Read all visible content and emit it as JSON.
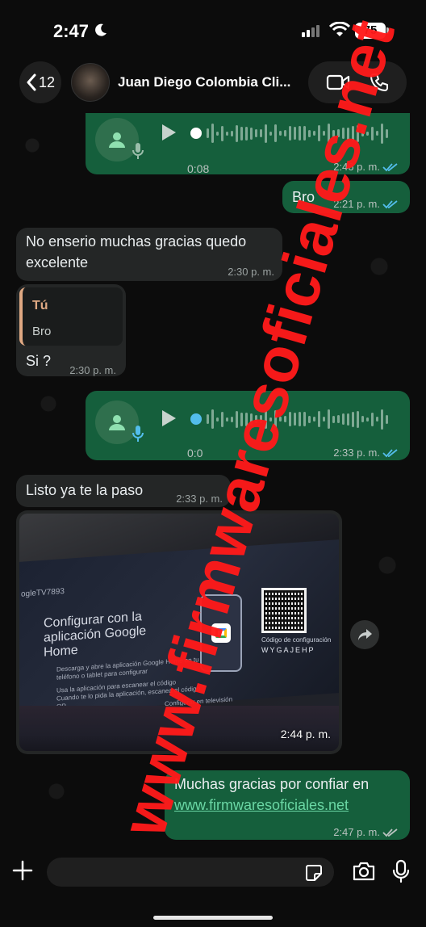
{
  "status_bar": {
    "time": "2:47",
    "battery": "75"
  },
  "header": {
    "back_count": "12",
    "contact_name": "Juan Diego Colombia Cli..."
  },
  "messages": [
    {
      "id": "m1",
      "type": "voice",
      "direction": "out",
      "duration": "0:08",
      "time": "2:46 p. m."
    },
    {
      "id": "m2",
      "type": "text",
      "direction": "out",
      "text": "Bro",
      "time": "2:21 p. m."
    },
    {
      "id": "m3",
      "type": "text",
      "direction": "in",
      "text": "No enserio muchas gracias quedo excelente",
      "time": "2:30 p. m."
    },
    {
      "id": "m4",
      "type": "reply",
      "direction": "in",
      "quote_author": "Tú",
      "quote_text": "Bro",
      "text": "Si ?",
      "time": "2:30 p. m."
    },
    {
      "id": "m5",
      "type": "voice",
      "direction": "out",
      "duration": "0:0",
      "time": "2:33 p. m."
    },
    {
      "id": "m6",
      "type": "text",
      "direction": "in",
      "text": "Listo ya te la paso",
      "time": "2:33 p. m."
    },
    {
      "id": "m7",
      "type": "image",
      "direction": "in",
      "time": "2:44 p. m.",
      "photo_text": {
        "device_id": "ogleTV7893",
        "title": "Configurar con la aplicación Google Home",
        "line1": "Descarga y abre la aplicación Google Home en tu",
        "line2": "teléfono o tablet para configurar",
        "line3": "Usa la aplicación para escanear el código",
        "line4": "Cuando te lo pida la aplicación, escanea el código",
        "line5": "QR.",
        "bottom": "Configurar en televisión",
        "qr_caption": "Código de configuración",
        "qr_code": "WYGAJEHP"
      }
    },
    {
      "id": "m8",
      "type": "text",
      "direction": "out",
      "text": "Muchas gracias por confiar en",
      "link": "www.firmwaresoficiales.net",
      "time": "2:47 p. m."
    }
  ],
  "input": {
    "placeholder": ""
  },
  "watermark": "www.firmwaresoficiales.net",
  "colors": {
    "outgoing": "#155f3c",
    "incoming": "#242626",
    "read_ticks": "#53bdeb",
    "watermark": "#ff1a1a"
  }
}
